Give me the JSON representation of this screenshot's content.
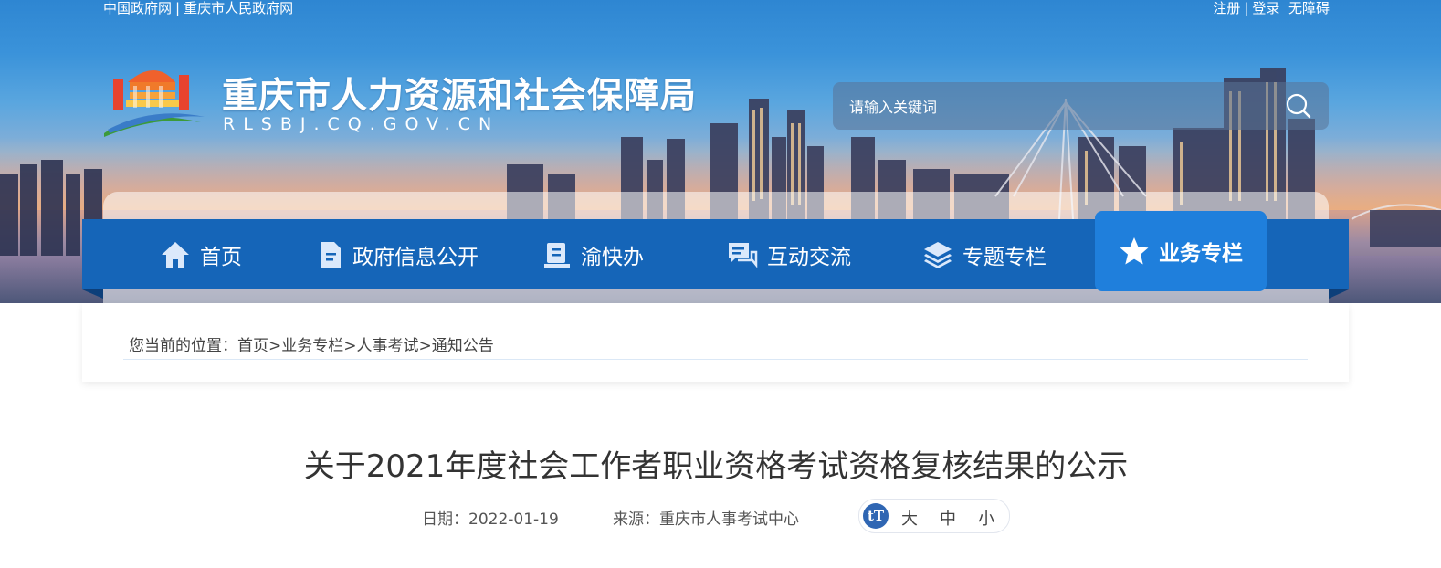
{
  "top_links_left": [
    "中国政府网",
    "重庆市人民政府网"
  ],
  "top_links_right": [
    "注册",
    "登录",
    "无障碍"
  ],
  "header": {
    "site_title": "重庆市人力资源和社会保障局",
    "site_domain": "RLSBJ.CQ.GOV.CN",
    "search_placeholder": "请输入关键词"
  },
  "nav": {
    "items": [
      {
        "label": "首页",
        "icon": "home-icon"
      },
      {
        "label": "政府信息公开",
        "icon": "document-icon"
      },
      {
        "label": "渝快办",
        "icon": "book-icon"
      },
      {
        "label": "互动交流",
        "icon": "chat-icon"
      },
      {
        "label": "专题专栏",
        "icon": "layers-icon"
      },
      {
        "label": "业务专栏",
        "icon": "star-icon",
        "active": true
      }
    ]
  },
  "breadcrumb": {
    "prefix": "您当前的位置：",
    "items": [
      "首页",
      "业务专栏",
      "人事考试",
      "通知公告"
    ],
    "separator": ">"
  },
  "article": {
    "title": "关于2021年度社会工作者职业资格考试资格复核结果的公示",
    "date_label": "日期：",
    "date": "2022-01-19",
    "source_label": "来源：",
    "source": "重庆市人事考试中心",
    "font_size_icon_text": "tT",
    "font_sizes": [
      "大",
      "中",
      "小"
    ]
  },
  "colors": {
    "nav_blue": "#1565b8",
    "nav_active": "#1f7fdc",
    "text_dark": "#333333"
  }
}
